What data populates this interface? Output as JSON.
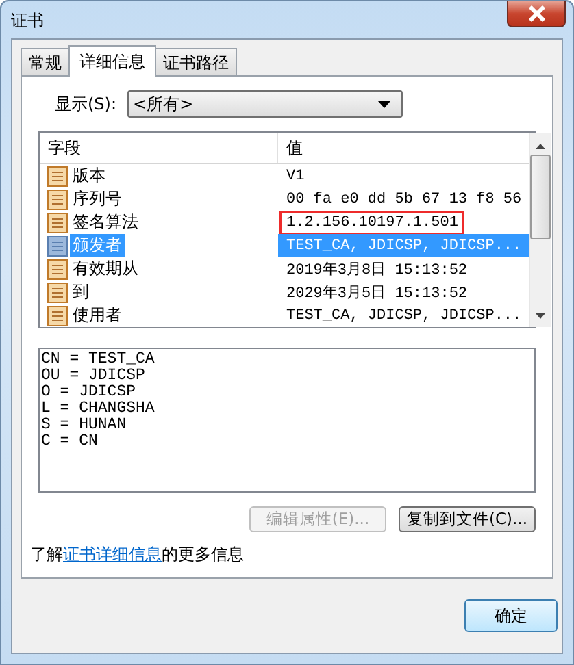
{
  "window": {
    "title": "证书"
  },
  "tabs": [
    {
      "label": "常规",
      "selected": false
    },
    {
      "label": "详细信息",
      "selected": true
    },
    {
      "label": "证书路径",
      "selected": false
    }
  ],
  "show": {
    "label": "显示(S):",
    "value": "<所有>"
  },
  "fields_table": {
    "columns": [
      "字段",
      "值"
    ],
    "rows": [
      {
        "field": "版本",
        "value": "V1",
        "selected": false,
        "highlighted": false
      },
      {
        "field": "序列号",
        "value": "00 fa e0 dd 5b 67 13 f8 56",
        "selected": false,
        "highlighted": false
      },
      {
        "field": "签名算法",
        "value": "1.2.156.10197.1.501",
        "selected": false,
        "highlighted": true
      },
      {
        "field": "颁发者",
        "value": "TEST_CA, JDICSP, JDICSP...",
        "selected": true,
        "highlighted": false
      },
      {
        "field": "有效期从",
        "value": "2019年3月8日 15:13:52",
        "selected": false,
        "highlighted": false
      },
      {
        "field": "到",
        "value": "2029年3月5日 15:13:52",
        "selected": false,
        "highlighted": false
      },
      {
        "field": "使用者",
        "value": "TEST_CA, JDICSP, JDICSP...",
        "selected": false,
        "highlighted": false
      }
    ]
  },
  "details": [
    "CN = TEST_CA",
    "OU = JDICSP",
    "O = JDICSP",
    "L = CHANGSHA",
    "S = HUNAN",
    "C = CN"
  ],
  "buttons": [
    {
      "label": "编辑属性(E)...",
      "disabled": true
    },
    {
      "label": "复制到文件(C)...",
      "disabled": false
    }
  ],
  "info": {
    "before": "了解",
    "link": "证书详细信息",
    "after": "的更多信息"
  },
  "ok_button": {
    "label": "确定"
  }
}
